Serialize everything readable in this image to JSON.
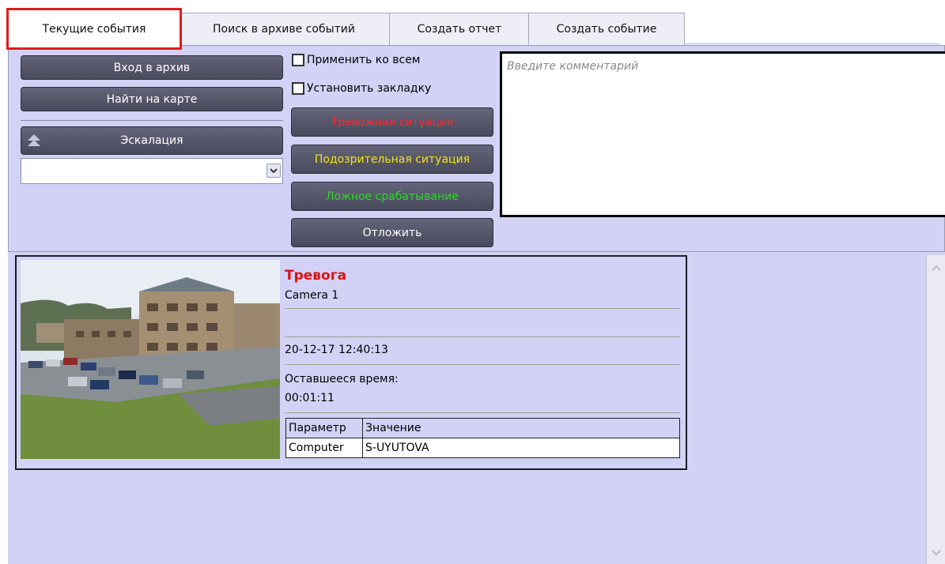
{
  "tabs": [
    {
      "label": "Текущие события",
      "active": true
    },
    {
      "label": "Поиск в архиве событий",
      "active": false
    },
    {
      "label": "Создать отчет",
      "active": false
    },
    {
      "label": "Создать событие",
      "active": false
    }
  ],
  "left_buttons": {
    "archive": "Вход в архив",
    "map": "Найти на карте",
    "escalation": "Эскалация"
  },
  "escalation_select": {
    "value": ""
  },
  "checkboxes": {
    "apply_all": {
      "label": "Применить ко всем",
      "checked": false
    },
    "bookmark": {
      "label": "Установить закладку",
      "checked": false
    }
  },
  "reaction_buttons": {
    "alarm": {
      "label": "Тревожная ситуация",
      "color": "#ff2a2a"
    },
    "suspicious": {
      "label": "Подозрительная ситуация",
      "color": "#f2e21a"
    },
    "false_alarm": {
      "label": "Ложное срабатывание",
      "color": "#2fd42f"
    },
    "postpone": {
      "label": "Отложить",
      "color": "#ffffff"
    }
  },
  "comment": {
    "placeholder": "Введите комментарий"
  },
  "event": {
    "type": "Тревога",
    "type_color": "#e01010",
    "source": "Camera 1",
    "timestamp": "20-12-17 12:40:13",
    "remaining_label": "Оставшееся время:",
    "remaining_value": "00:01:11",
    "table": {
      "headers": [
        "Параметр",
        "Значение"
      ],
      "rows": [
        [
          "Computer",
          "S-UYUTOVA"
        ]
      ]
    }
  },
  "colors": {
    "panel_bg": "#d2d2f6",
    "active_tab_outline": "#e01b1b",
    "button_bg": "#525266"
  }
}
